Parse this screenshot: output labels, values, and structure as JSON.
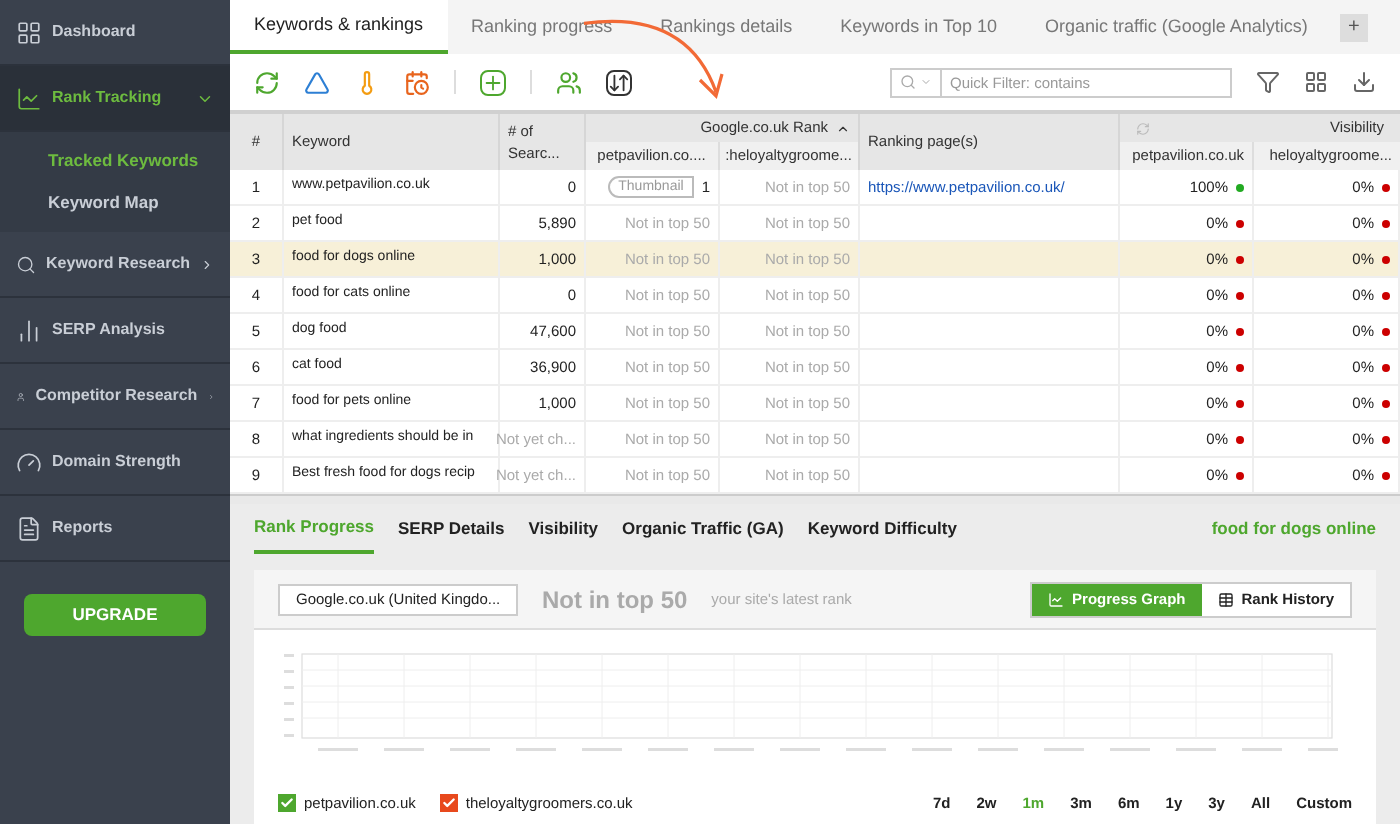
{
  "sidebar": {
    "items": [
      {
        "label": "Dashboard",
        "selected": false
      },
      {
        "label": "Rank Tracking",
        "selected": true,
        "expanded": true,
        "children": [
          {
            "label": "Tracked Keywords",
            "selected": true
          },
          {
            "label": "Keyword Map",
            "selected": false
          }
        ]
      },
      {
        "label": "Keyword Research",
        "selected": false,
        "expanded": false
      },
      {
        "label": "SERP Analysis",
        "selected": false
      },
      {
        "label": "Competitor Research",
        "selected": false,
        "expanded": false
      },
      {
        "label": "Domain Strength",
        "selected": false
      },
      {
        "label": "Reports",
        "selected": false
      }
    ],
    "upgrade": "UPGRADE"
  },
  "tabs": [
    {
      "label": "Keywords & rankings",
      "selected": true
    },
    {
      "label": "Ranking progress",
      "selected": false
    },
    {
      "label": "Rankings details",
      "selected": false
    },
    {
      "label": "Keywords in Top 10",
      "selected": false
    },
    {
      "label": "Organic traffic (Google Analytics)",
      "selected": false
    }
  ],
  "add_tab": "+",
  "search": {
    "placeholder": "Quick Filter: contains"
  },
  "table": {
    "columns": {
      "number": "#",
      "keyword": "Keyword",
      "searches": "# of Searc...",
      "rank_group": "Google.co.uk Rank",
      "rank_1": "petpavilion.co....",
      "rank_2": ":heloyaltygroome...",
      "page": "Ranking page(s)",
      "visibility_group": "Visibility",
      "visibility_1": "petpavilion.co.uk",
      "visibility_2": "heloyaltygroome..."
    },
    "rows": [
      {
        "number": "1",
        "keyword": "www.petpavilion.co.uk",
        "searches": {
          "text": "0",
          "muted": false
        },
        "rank_1": {
          "text": "1",
          "muted": false,
          "thumbnail": "Thumbnail"
        },
        "rank_2": {
          "text": "Not in top 50",
          "muted": true
        },
        "page": "https://www.petpavilion.co.uk/",
        "visibility_1": {
          "text": "100%",
          "color": "#22aa22"
        },
        "visibility_2": {
          "text": "0%",
          "color": "#cc0000"
        },
        "selected": false
      },
      {
        "number": "2",
        "keyword": "pet food",
        "searches": {
          "text": "5,890",
          "muted": false
        },
        "rank_1": {
          "text": "Not in top 50",
          "muted": true
        },
        "rank_2": {
          "text": "Not in top 50",
          "muted": true
        },
        "visibility_1": {
          "text": "0%",
          "color": "#cc0000"
        },
        "visibility_2": {
          "text": "0%",
          "color": "#cc0000"
        },
        "selected": false
      },
      {
        "number": "3",
        "keyword": "food for dogs online",
        "searches": {
          "text": "1,000",
          "muted": false
        },
        "rank_1": {
          "text": "Not in top 50",
          "muted": true
        },
        "rank_2": {
          "text": "Not in top 50",
          "muted": true
        },
        "visibility_1": {
          "text": "0%",
          "color": "#cc0000"
        },
        "visibility_2": {
          "text": "0%",
          "color": "#cc0000"
        },
        "selected": true
      },
      {
        "number": "4",
        "keyword": "food for cats online",
        "searches": {
          "text": "0",
          "muted": false
        },
        "rank_1": {
          "text": "Not in top 50",
          "muted": true
        },
        "rank_2": {
          "text": "Not in top 50",
          "muted": true
        },
        "visibility_1": {
          "text": "0%",
          "color": "#cc0000"
        },
        "visibility_2": {
          "text": "0%",
          "color": "#cc0000"
        },
        "selected": false
      },
      {
        "number": "5",
        "keyword": "dog food",
        "searches": {
          "text": "47,600",
          "muted": false
        },
        "rank_1": {
          "text": "Not in top 50",
          "muted": true
        },
        "rank_2": {
          "text": "Not in top 50",
          "muted": true
        },
        "visibility_1": {
          "text": "0%",
          "color": "#cc0000"
        },
        "visibility_2": {
          "text": "0%",
          "color": "#cc0000"
        },
        "selected": false
      },
      {
        "number": "6",
        "keyword": "cat food",
        "searches": {
          "text": "36,900",
          "muted": false
        },
        "rank_1": {
          "text": "Not in top 50",
          "muted": true
        },
        "rank_2": {
          "text": "Not in top 50",
          "muted": true
        },
        "visibility_1": {
          "text": "0%",
          "color": "#cc0000"
        },
        "visibility_2": {
          "text": "0%",
          "color": "#cc0000"
        },
        "selected": false
      },
      {
        "number": "7",
        "keyword": "food for pets online",
        "searches": {
          "text": "1,000",
          "muted": false
        },
        "rank_1": {
          "text": "Not in top 50",
          "muted": true
        },
        "rank_2": {
          "text": "Not in top 50",
          "muted": true
        },
        "visibility_1": {
          "text": "0%",
          "color": "#cc0000"
        },
        "visibility_2": {
          "text": "0%",
          "color": "#cc0000"
        },
        "selected": false
      },
      {
        "number": "8",
        "keyword": "what ingredients should be in",
        "searches": {
          "text": "Not yet ch...",
          "muted": true
        },
        "rank_1": {
          "text": "Not in top 50",
          "muted": true
        },
        "rank_2": {
          "text": "Not in top 50",
          "muted": true
        },
        "visibility_1": {
          "text": "0%",
          "color": "#cc0000"
        },
        "visibility_2": {
          "text": "0%",
          "color": "#cc0000"
        },
        "selected": false
      },
      {
        "number": "9",
        "keyword": "Best fresh food for dogs recip",
        "searches": {
          "text": "Not yet ch...",
          "muted": true
        },
        "rank_1": {
          "text": "Not in top 50",
          "muted": true
        },
        "rank_2": {
          "text": "Not in top 50",
          "muted": true
        },
        "visibility_1": {
          "text": "0%",
          "color": "#cc0000"
        },
        "visibility_2": {
          "text": "0%",
          "color": "#cc0000"
        },
        "selected": false
      }
    ]
  },
  "details": {
    "tabs": [
      {
        "label": "Rank Progress",
        "selected": true
      },
      {
        "label": "SERP Details",
        "selected": false
      },
      {
        "label": "Visibility",
        "selected": false
      },
      {
        "label": "Organic Traffic (GA)",
        "selected": false
      },
      {
        "label": "Keyword Difficulty",
        "selected": false
      }
    ],
    "keyword": "food for dogs online",
    "engine": "Google.co.uk (United Kingdo...",
    "rank": "Not in top 50",
    "rank_note": "your site's latest rank",
    "views": [
      {
        "label": "Progress Graph",
        "selected": true
      },
      {
        "label": "Rank History",
        "selected": false
      }
    ],
    "legend": [
      {
        "label": "petpavilion.co.uk",
        "checked": true,
        "color": "#4ea72e"
      },
      {
        "label": "theloyaltygroomers.co.uk",
        "checked": true,
        "color": "#e8491d"
      }
    ],
    "ranges": [
      {
        "label": "7d",
        "selected": false
      },
      {
        "label": "2w",
        "selected": false
      },
      {
        "label": "1m",
        "selected": true
      },
      {
        "label": "3m",
        "selected": false
      },
      {
        "label": "6m",
        "selected": false
      },
      {
        "label": "1y",
        "selected": false
      },
      {
        "label": "3y",
        "selected": false
      },
      {
        "label": "All",
        "selected": false
      },
      {
        "label": "Custom",
        "selected": false
      }
    ]
  }
}
